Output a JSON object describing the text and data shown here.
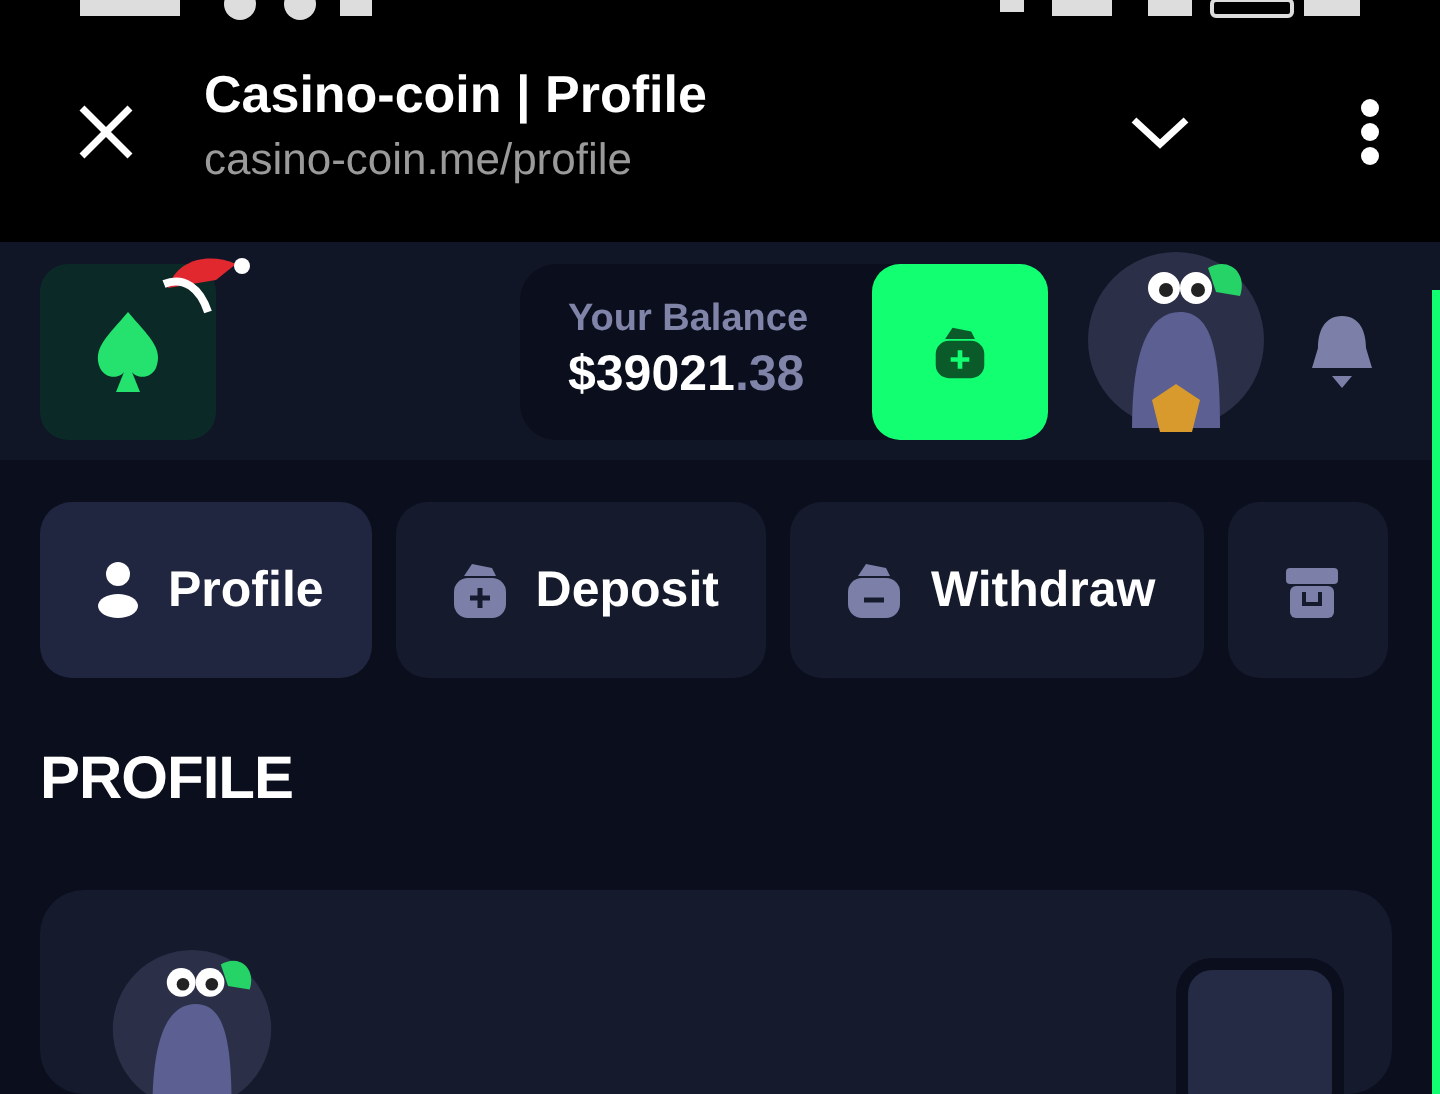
{
  "browser": {
    "title": "Casino-coin | Profile",
    "url": "casino-coin.me/profile"
  },
  "header": {
    "balance_label": "Your Balance",
    "balance_whole": "$39021",
    "balance_cents": ".38"
  },
  "tabs": [
    {
      "kind": "profile",
      "label": "Profile",
      "selected": true
    },
    {
      "kind": "deposit",
      "label": "Deposit",
      "selected": false
    },
    {
      "kind": "withdraw",
      "label": "Withdraw",
      "selected": false
    },
    {
      "kind": "gift",
      "selected": false
    }
  ],
  "section_title": "PROFILE"
}
